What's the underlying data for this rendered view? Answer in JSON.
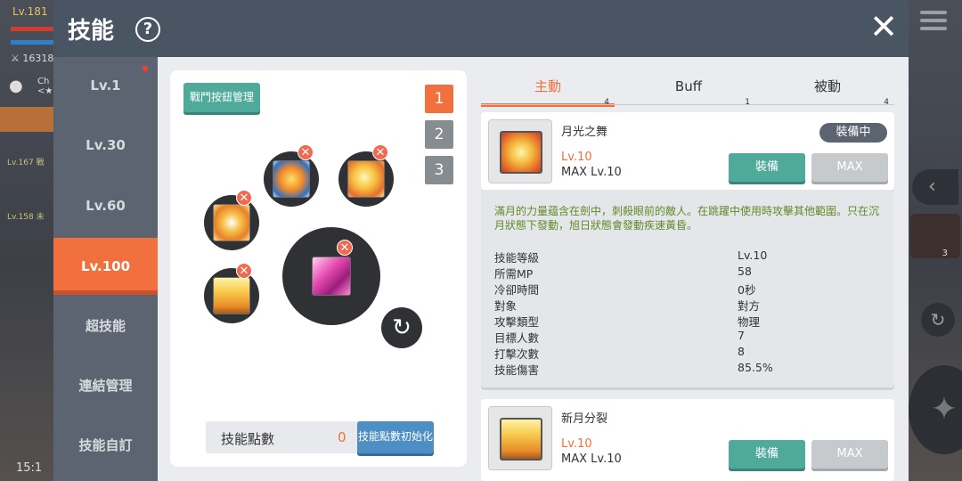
{
  "hud": {
    "level": "Lv.181",
    "power": "16318",
    "location": "Ch",
    "location_sub": "<★",
    "mob1": "Lv.167",
    "mob1_name": "戰",
    "mob2": "Lv.158",
    "mob2_name": "未",
    "clock": "15:1",
    "side_count": "3"
  },
  "dialog": {
    "title": "技能",
    "help": "?",
    "close": "✕"
  },
  "nav": {
    "items": [
      {
        "label": "Lv.1"
      },
      {
        "label": "Lv.30"
      },
      {
        "label": "Lv.60"
      },
      {
        "label": "Lv.100"
      },
      {
        "label": "超技能"
      },
      {
        "label": "連結管理"
      },
      {
        "label": "技能自訂"
      }
    ],
    "active_index": 3
  },
  "left": {
    "battle_button": "戰鬥按鈕管理",
    "presets": [
      "1",
      "2",
      "3"
    ],
    "active_preset": "1",
    "slot_remove": "✕",
    "refresh": "↻",
    "skill_points_label": "技能點數",
    "skill_points_value": "0",
    "reset_button": "技能點數初始化"
  },
  "tabs": [
    {
      "label": "主動",
      "count": "4"
    },
    {
      "label": "Buff",
      "count": "1"
    },
    {
      "label": "被動",
      "count": "4"
    }
  ],
  "skills": [
    {
      "name": "月光之舞",
      "level": "Lv.10",
      "max_level": "MAX Lv.10",
      "badge": "裝備中",
      "equip": "裝備",
      "max": "MAX"
    },
    {
      "name": "新月分裂",
      "level": "Lv.10",
      "max_level": "MAX Lv.10",
      "equip": "裝備",
      "max": "MAX"
    }
  ],
  "detail": {
    "description": "滿月的力量蕴含在劍中，刺殺眼前的敵人。在跳躍中使用時攻擊其他範圍。只在沉月狀態下發動，旭日狀態會發動疾速黃昏。",
    "stats": [
      {
        "key": "技能等級",
        "value": "Lv.10"
      },
      {
        "key": "所需MP",
        "value": "58"
      },
      {
        "key": "冷卻時間",
        "value": "0秒"
      },
      {
        "key": "對象",
        "value": "對方"
      },
      {
        "key": "攻擊類型",
        "value": "物理"
      },
      {
        "key": "目標人數",
        "value": "7"
      },
      {
        "key": "打擊次數",
        "value": "8"
      },
      {
        "key": "技能傷害",
        "value": "85.5%"
      }
    ]
  },
  "colors": {
    "accent": "#f26f3e",
    "teal": "#4faa9a",
    "header": "#4a5563",
    "description": "#5f8a2a"
  }
}
